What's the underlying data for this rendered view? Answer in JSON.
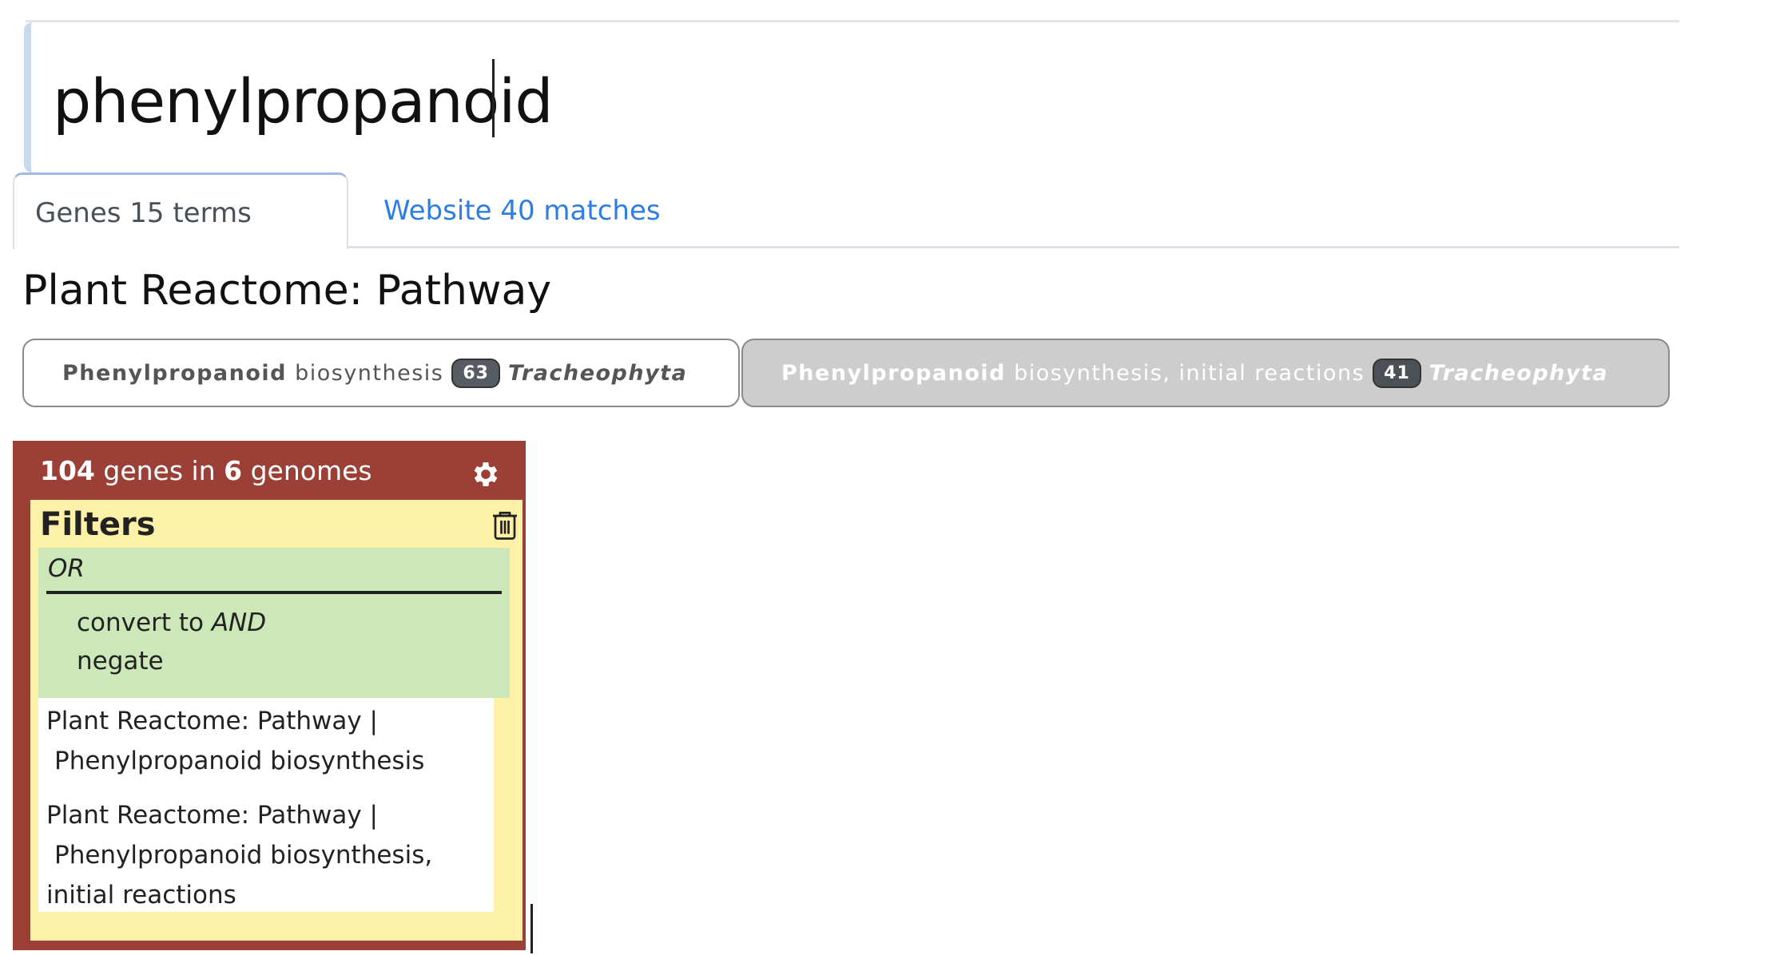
{
  "search": {
    "query": "phenylpropanoid"
  },
  "tabs": [
    {
      "label": "Genes 15 terms",
      "active": true
    },
    {
      "label": "Website 40 matches",
      "active": false
    }
  ],
  "section": {
    "title": "Plant Reactome: Pathway"
  },
  "pathways": [
    {
      "bold": "Phenylpropanoid",
      "rest": "biosynthesis",
      "count": "63",
      "taxon": "Tracheophyta",
      "selected": true
    },
    {
      "bold": "Phenylpropanoid",
      "rest": "biosynthesis, initial reactions",
      "count": "41",
      "taxon": "Tracheophyta",
      "selected": false
    }
  ],
  "results_panel": {
    "gene_count": "104",
    "genes_label": "genes in",
    "genome_count": "6",
    "genomes_label": "genomes",
    "filters_title": "Filters",
    "operator": "OR",
    "convert_prefix": "convert to",
    "convert_target": "AND",
    "negate_label": "negate",
    "terms": [
      {
        "line1": "Plant Reactome: Pathway |",
        "line2": "Phenylpropanoid biosynthesis",
        "line3": ""
      },
      {
        "line1": "Plant Reactome: Pathway |",
        "line2": "Phenylpropanoid biosynthesis,",
        "line3": "initial reactions"
      }
    ]
  },
  "colors": {
    "panel_bg": "#9b3f37",
    "filters_bg": "#fdf1a8",
    "or_block_bg": "#cce8b9",
    "link": "#2f7de1"
  },
  "icons": [
    "gear-icon",
    "trash-icon"
  ]
}
